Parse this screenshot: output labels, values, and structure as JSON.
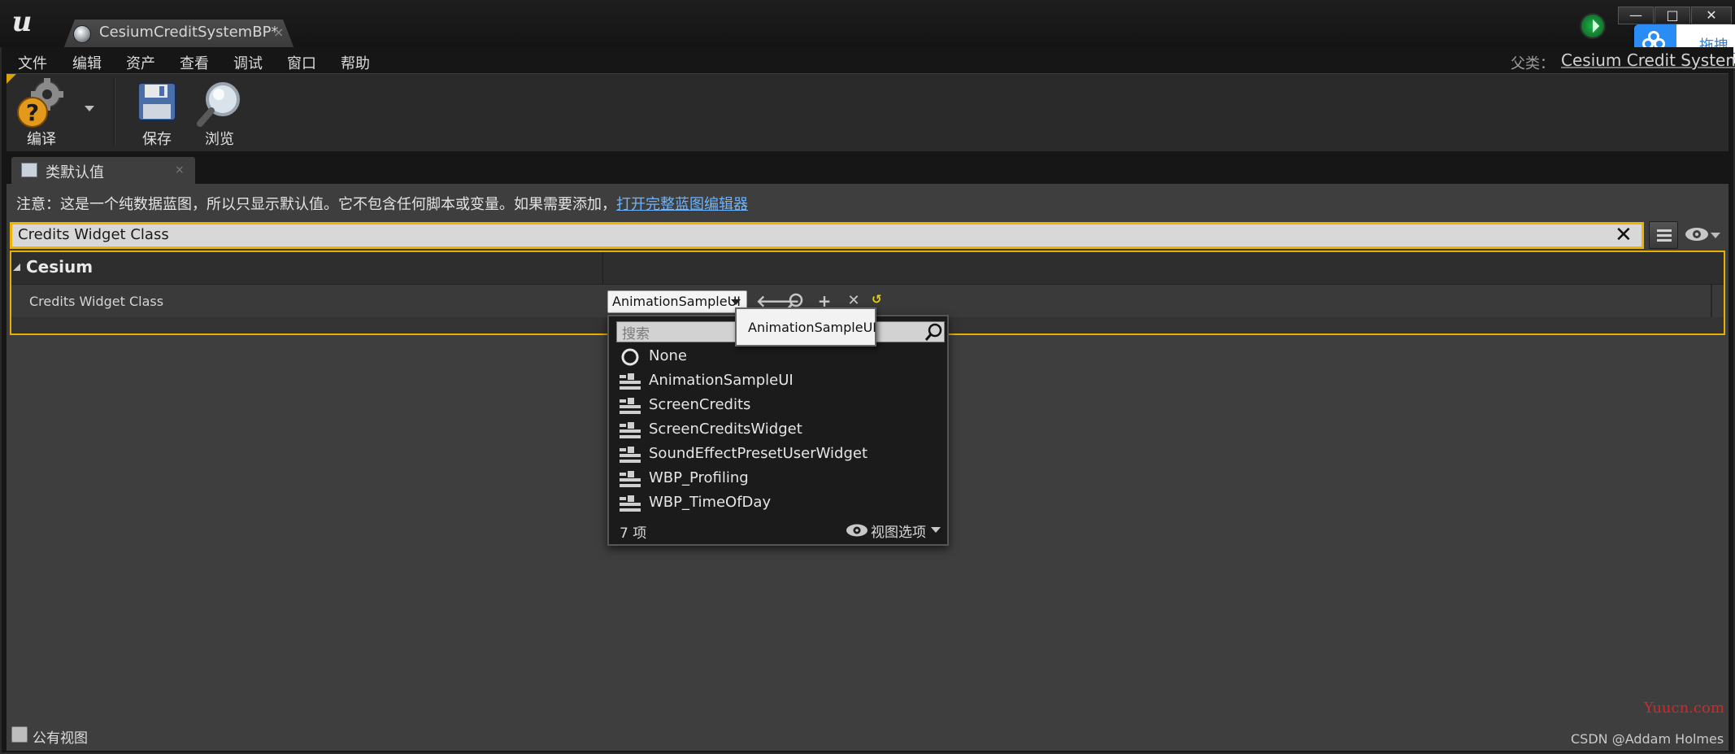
{
  "titlebar": {
    "tab_title": "CesiumCreditSystemBP*",
    "tab_close": "×",
    "logo": "ue-logo-icon",
    "min": "—",
    "max": "□",
    "close": "✕"
  },
  "baidu": {
    "label": "拖拽_",
    "icon": "baidu-netdisk-icon"
  },
  "menu": {
    "items": [
      "文件",
      "编辑",
      "资产",
      "查看",
      "调试",
      "窗口",
      "帮助"
    ],
    "parent_label": "父类：",
    "parent_value": "Cesium Credit System"
  },
  "toolbar": {
    "compile": "编译",
    "save": "保存",
    "browse": "浏览"
  },
  "panel": {
    "tab_label": "类默认值",
    "tab_close": "×",
    "notice": "注意：这是一个纯数据蓝图，所以只显示默认值。它不包含任何脚本或变量。如果需要添加，",
    "notice_link": "打开完整蓝图编辑器",
    "search_value": "Credits Widget Class",
    "search_clear": "✕"
  },
  "details": {
    "category": "Cesium",
    "property_label": "Credits Widget Class",
    "property_value": "AnimationSampleUI",
    "reset_icon": "↺"
  },
  "dropdown": {
    "search_placeholder": "搜索",
    "items": [
      {
        "label": "None",
        "icon": "none-circle-icon"
      },
      {
        "label": "AnimationSampleUI",
        "icon": "widget-class-icon"
      },
      {
        "label": "ScreenCredits",
        "icon": "widget-class-icon"
      },
      {
        "label": "ScreenCreditsWidget",
        "icon": "widget-class-icon"
      },
      {
        "label": "SoundEffectPresetUserWidget",
        "icon": "widget-class-icon"
      },
      {
        "label": "WBP_Profiling",
        "icon": "widget-class-icon"
      },
      {
        "label": "WBP_TimeOfDay",
        "icon": "widget-class-icon"
      }
    ],
    "count": "7 项",
    "view_options": "视图选项"
  },
  "tooltip": "AnimationSampleUI",
  "footer": {
    "public_view": "公有视图",
    "watermark_red": "Yuucn.com",
    "watermark_csdn": "CSDN @Addam Holmes"
  },
  "colors": {
    "accent": "#f0b400",
    "link": "#6cb4ff",
    "panel_bg": "#3e3e3e"
  }
}
